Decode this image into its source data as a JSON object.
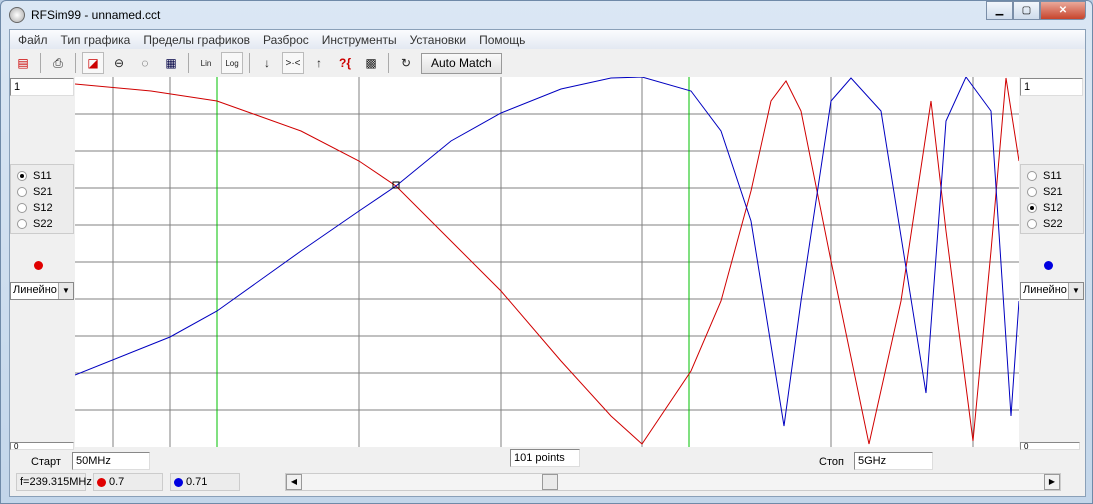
{
  "window": {
    "title": "RFSim99 - unnamed.cct"
  },
  "menu": [
    "Файл",
    "Тип графика",
    "Пределы графиков",
    "Разброс",
    "Инструменты",
    "Установки",
    "Помощь"
  ],
  "toolbar": {
    "lin": "Lin",
    "log": "Log",
    "auto_match": "Auto Match"
  },
  "left_panel": {
    "max": "1",
    "min": "0",
    "options": [
      "S11",
      "S21",
      "S12",
      "S22"
    ],
    "selected": "S11",
    "trace_color": "#e00000",
    "scale": "Линейно"
  },
  "right_panel": {
    "max": "1",
    "min": "0",
    "options": [
      "S11",
      "S21",
      "S12",
      "S22"
    ],
    "selected": "S12",
    "trace_color": "#0000e0",
    "scale": "Линейно"
  },
  "bottom": {
    "start_label": "Старт",
    "start_value": "50MHz",
    "points": "101 points",
    "stop_label": "Стоп",
    "stop_value": "5GHz"
  },
  "status": {
    "freq": "f=239.315MHz",
    "red_value": "0.7",
    "blue_value": "0.71"
  },
  "colors": {
    "s11": "#d00000",
    "s12": "#0000c0",
    "marker": "#00c000",
    "grid": "#808080"
  }
}
